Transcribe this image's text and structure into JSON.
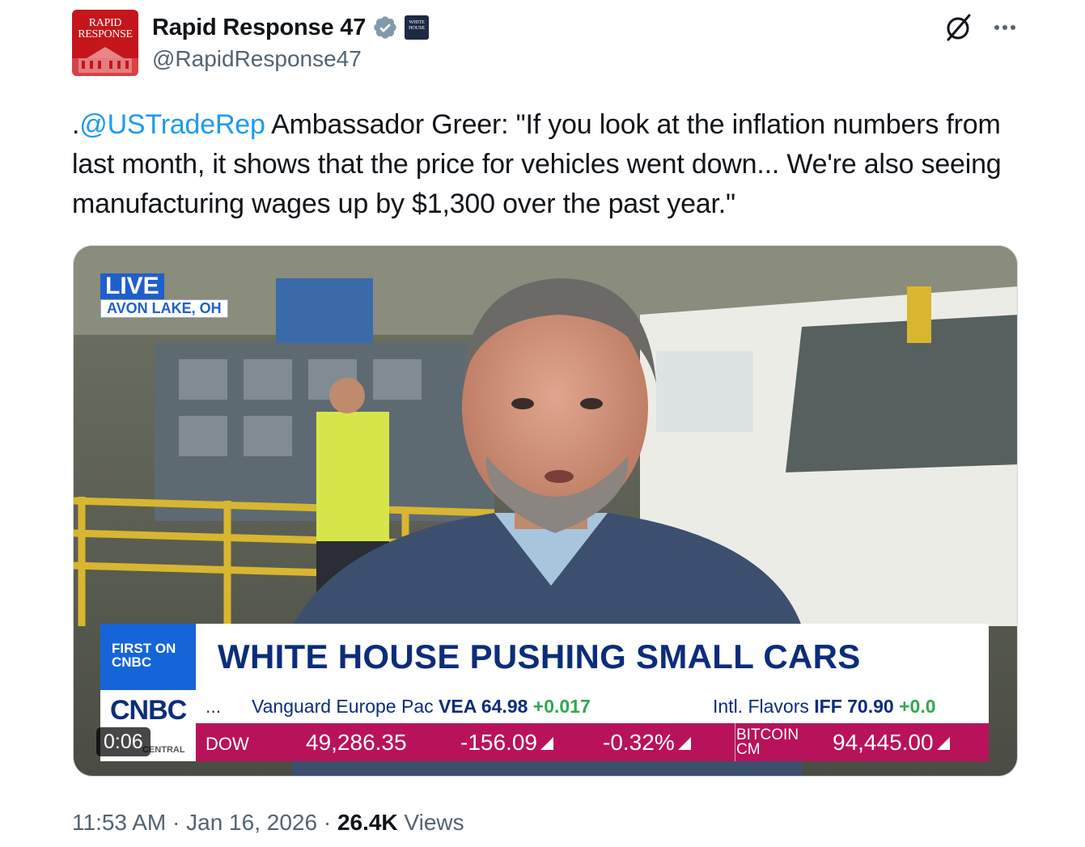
{
  "account": {
    "display_name": "Rapid Response 47",
    "handle": "@RapidResponse47",
    "avatar_text_line1": "RAPID",
    "avatar_text_line2": "RESPONSE",
    "affiliate_badge_text": "WHITE HOUSE",
    "verified_color": "#829aab"
  },
  "tweet": {
    "prefix": ".",
    "mention": "@USTradeRep",
    "body": " Ambassador Greer: \"If you look at the inflation numbers from last month, it shows that the price for vehicles went down... We're also seeing manufacturing wages up by $1,300 over the past year.\""
  },
  "video": {
    "live_label": "LIVE",
    "location": "AVON LAKE, OH",
    "first_on": "FIRST ON CNBC",
    "headline": "WHITE HOUSE PUSHING SMALL CARS",
    "network": "CNBC",
    "network_sub": "CENTRAL",
    "elapsed": "0:06",
    "ticker_dots": "...",
    "ticker_q1_name": "Vanguard Europe Pac ",
    "ticker_q1_symbol": "VEA 64.98",
    "ticker_q1_change": " +0.017",
    "ticker_q2_name": "Intl. Flavors ",
    "ticker_q2_symbol": "IFF 70.90",
    "ticker_q2_change": " +0.0",
    "dow_label": "DOW",
    "dow_value": "49,286.35",
    "dow_change": "-156.09",
    "dow_pct": "-0.32%",
    "btc_label": "BITCOIN CM",
    "btc_value": "94,445.00",
    "accent_blue": "#1565d8",
    "ticker_magenta": "#b8135a"
  },
  "footer": {
    "time": "11:53 AM",
    "sep1": " · ",
    "date": "Jan 16, 2026",
    "sep2": " · ",
    "views_count": "26.4K",
    "views_label": " Views"
  }
}
